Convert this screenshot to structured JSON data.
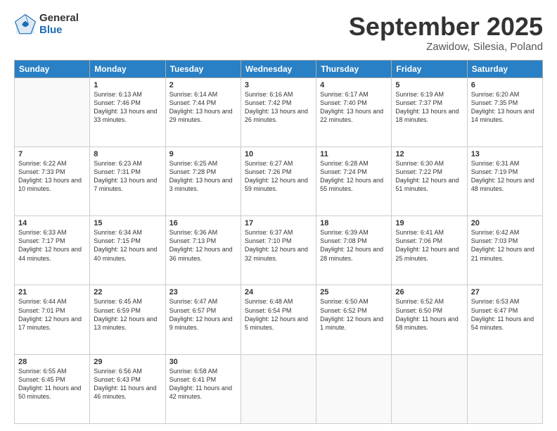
{
  "logo": {
    "general": "General",
    "blue": "Blue"
  },
  "title": {
    "month": "September 2025",
    "location": "Zawidow, Silesia, Poland"
  },
  "days_of_week": [
    "Sunday",
    "Monday",
    "Tuesday",
    "Wednesday",
    "Thursday",
    "Friday",
    "Saturday"
  ],
  "weeks": [
    [
      {
        "day": "",
        "info": ""
      },
      {
        "day": "1",
        "info": "Sunrise: 6:13 AM\nSunset: 7:46 PM\nDaylight: 13 hours\nand 33 minutes."
      },
      {
        "day": "2",
        "info": "Sunrise: 6:14 AM\nSunset: 7:44 PM\nDaylight: 13 hours\nand 29 minutes."
      },
      {
        "day": "3",
        "info": "Sunrise: 6:16 AM\nSunset: 7:42 PM\nDaylight: 13 hours\nand 26 minutes."
      },
      {
        "day": "4",
        "info": "Sunrise: 6:17 AM\nSunset: 7:40 PM\nDaylight: 13 hours\nand 22 minutes."
      },
      {
        "day": "5",
        "info": "Sunrise: 6:19 AM\nSunset: 7:37 PM\nDaylight: 13 hours\nand 18 minutes."
      },
      {
        "day": "6",
        "info": "Sunrise: 6:20 AM\nSunset: 7:35 PM\nDaylight: 13 hours\nand 14 minutes."
      }
    ],
    [
      {
        "day": "7",
        "info": "Sunrise: 6:22 AM\nSunset: 7:33 PM\nDaylight: 13 hours\nand 10 minutes."
      },
      {
        "day": "8",
        "info": "Sunrise: 6:23 AM\nSunset: 7:31 PM\nDaylight: 13 hours\nand 7 minutes."
      },
      {
        "day": "9",
        "info": "Sunrise: 6:25 AM\nSunset: 7:28 PM\nDaylight: 13 hours\nand 3 minutes."
      },
      {
        "day": "10",
        "info": "Sunrise: 6:27 AM\nSunset: 7:26 PM\nDaylight: 12 hours\nand 59 minutes."
      },
      {
        "day": "11",
        "info": "Sunrise: 6:28 AM\nSunset: 7:24 PM\nDaylight: 12 hours\nand 55 minutes."
      },
      {
        "day": "12",
        "info": "Sunrise: 6:30 AM\nSunset: 7:22 PM\nDaylight: 12 hours\nand 51 minutes."
      },
      {
        "day": "13",
        "info": "Sunrise: 6:31 AM\nSunset: 7:19 PM\nDaylight: 12 hours\nand 48 minutes."
      }
    ],
    [
      {
        "day": "14",
        "info": "Sunrise: 6:33 AM\nSunset: 7:17 PM\nDaylight: 12 hours\nand 44 minutes."
      },
      {
        "day": "15",
        "info": "Sunrise: 6:34 AM\nSunset: 7:15 PM\nDaylight: 12 hours\nand 40 minutes."
      },
      {
        "day": "16",
        "info": "Sunrise: 6:36 AM\nSunset: 7:13 PM\nDaylight: 12 hours\nand 36 minutes."
      },
      {
        "day": "17",
        "info": "Sunrise: 6:37 AM\nSunset: 7:10 PM\nDaylight: 12 hours\nand 32 minutes."
      },
      {
        "day": "18",
        "info": "Sunrise: 6:39 AM\nSunset: 7:08 PM\nDaylight: 12 hours\nand 28 minutes."
      },
      {
        "day": "19",
        "info": "Sunrise: 6:41 AM\nSunset: 7:06 PM\nDaylight: 12 hours\nand 25 minutes."
      },
      {
        "day": "20",
        "info": "Sunrise: 6:42 AM\nSunset: 7:03 PM\nDaylight: 12 hours\nand 21 minutes."
      }
    ],
    [
      {
        "day": "21",
        "info": "Sunrise: 6:44 AM\nSunset: 7:01 PM\nDaylight: 12 hours\nand 17 minutes."
      },
      {
        "day": "22",
        "info": "Sunrise: 6:45 AM\nSunset: 6:59 PM\nDaylight: 12 hours\nand 13 minutes."
      },
      {
        "day": "23",
        "info": "Sunrise: 6:47 AM\nSunset: 6:57 PM\nDaylight: 12 hours\nand 9 minutes."
      },
      {
        "day": "24",
        "info": "Sunrise: 6:48 AM\nSunset: 6:54 PM\nDaylight: 12 hours\nand 5 minutes."
      },
      {
        "day": "25",
        "info": "Sunrise: 6:50 AM\nSunset: 6:52 PM\nDaylight: 12 hours\nand 1 minute."
      },
      {
        "day": "26",
        "info": "Sunrise: 6:52 AM\nSunset: 6:50 PM\nDaylight: 11 hours\nand 58 minutes."
      },
      {
        "day": "27",
        "info": "Sunrise: 6:53 AM\nSunset: 6:47 PM\nDaylight: 11 hours\nand 54 minutes."
      }
    ],
    [
      {
        "day": "28",
        "info": "Sunrise: 6:55 AM\nSunset: 6:45 PM\nDaylight: 11 hours\nand 50 minutes."
      },
      {
        "day": "29",
        "info": "Sunrise: 6:56 AM\nSunset: 6:43 PM\nDaylight: 11 hours\nand 46 minutes."
      },
      {
        "day": "30",
        "info": "Sunrise: 6:58 AM\nSunset: 6:41 PM\nDaylight: 11 hours\nand 42 minutes."
      },
      {
        "day": "",
        "info": ""
      },
      {
        "day": "",
        "info": ""
      },
      {
        "day": "",
        "info": ""
      },
      {
        "day": "",
        "info": ""
      }
    ]
  ]
}
